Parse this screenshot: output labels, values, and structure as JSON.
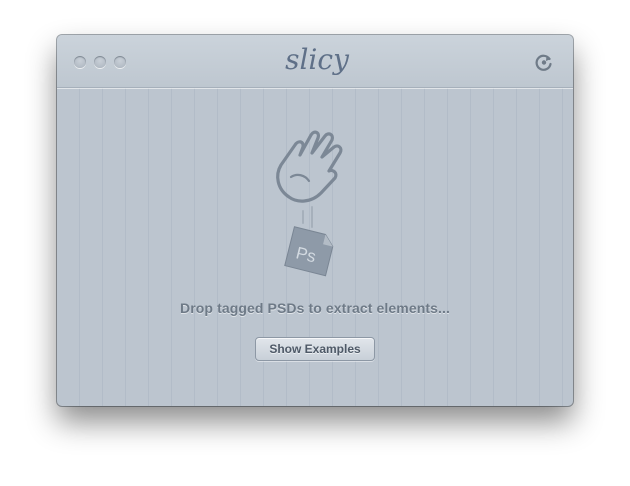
{
  "app": {
    "title": "slicy"
  },
  "titlebar": {
    "buttons": [
      "close",
      "minimize",
      "zoom"
    ],
    "refresh_icon": "refresh-icon"
  },
  "drop_zone": {
    "hand_icon": "hand-icon",
    "file_icon": "psd-file-icon",
    "file_badge": "Ps",
    "message": "Drop tagged PSDs to extract elements..."
  },
  "actions": {
    "show_examples_label": "Show Examples"
  },
  "colors": {
    "window_bg": "#bcc5cf",
    "text_muted": "#6e7a87",
    "icon_stroke": "#7c8896"
  }
}
